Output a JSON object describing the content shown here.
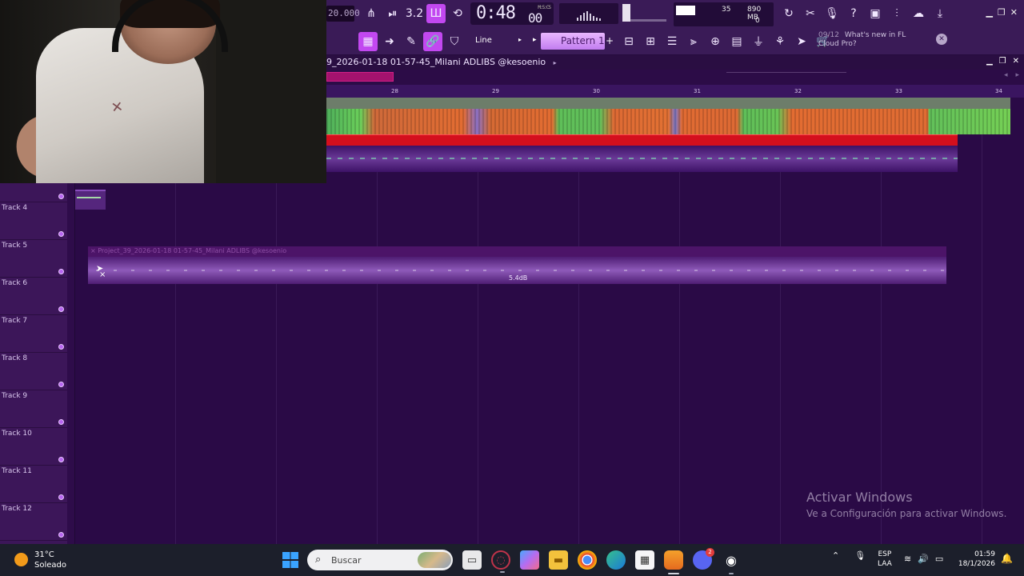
{
  "toolbar": {
    "tempo": "20.000",
    "time_main": "0:48",
    "time_sub": "00",
    "time_unit": "M:S:CS",
    "cpu_value": "35",
    "memory": "890 MB",
    "voices": "0",
    "snap_mode": "Line",
    "pattern": "Pattern 1",
    "news_date": "09/12",
    "news_text_1": "What's new in FL",
    "news_text_2": "Cloud Pro?"
  },
  "playlist": {
    "title": "9_2026-01-18 01-57-45_Milani ADLIBS @kesoenio",
    "ruler_labels": [
      "28",
      "29",
      "30",
      "31",
      "32",
      "33",
      "34"
    ],
    "tracks": [
      "Track 4",
      "Track 5",
      "Track 6",
      "Track 7",
      "Track 8",
      "Track 9",
      "Track 10",
      "Track 11",
      "Track 12"
    ],
    "clip_title": "Project_39_2026-01-18 01-57-45_Milani ADLIBS @kesoenio",
    "clip_gain": "5.4dB"
  },
  "watermark": {
    "title": "Activar Windows",
    "subtitle": "Ve a Configuración para activar Windows."
  },
  "taskbar": {
    "temperature": "31°C",
    "weather": "Soleado",
    "search_placeholder": "Buscar",
    "language_1": "ESP",
    "language_2": "LAA",
    "time": "01:59",
    "date": "18/1/2026",
    "discord_badge": "2"
  },
  "colors": {
    "accent": "#c248f0",
    "playlist_bg": "#2a0a46",
    "red_clip": "#d40f1d"
  }
}
